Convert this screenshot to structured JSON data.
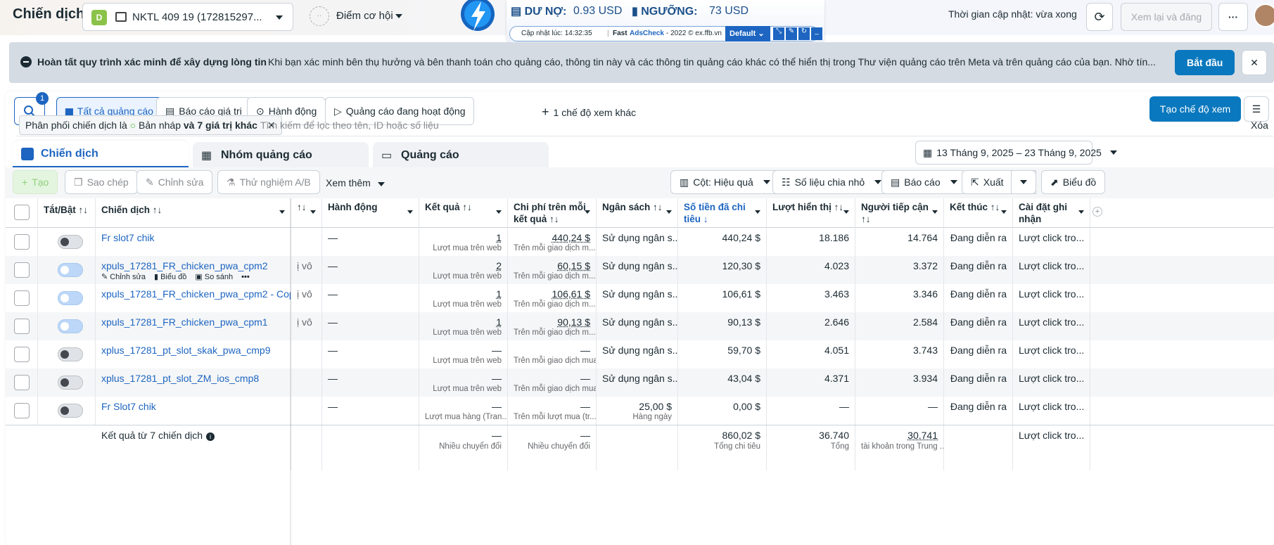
{
  "topbar": {
    "title": "Chiến dịch",
    "account_badge": "D",
    "account_name": "NKTL 409 19 (172815297...",
    "opportunity": "Điểm cơ hội",
    "debt_label": "DƯ NỢ:",
    "debt_value": "0.93 USD",
    "threshold_label": "NGƯỠNG:",
    "threshold_value": "73 USD",
    "ext_update": "Cập nhật lúc: 14:32:35",
    "ext_brand_fast": "Fast",
    "ext_brand_name": "AdsCheck",
    "ext_copyright": "- 2022 © ex.ffb.vn",
    "ext_profile": "Default",
    "update_time": "Thời gian cập nhật: vừa xong",
    "review_publish": "Xem lại và đăng",
    "more": "···"
  },
  "banner": {
    "title": "Hoàn tất quy trình xác minh để xây dựng lòng tin",
    "text": "Khi bạn xác minh bên thụ hưởng và bên thanh toán cho quảng cáo, thông tin này và các thông tin quảng cáo khác có thể hiển thị trong Thư viện quảng cáo trên Meta và trên quảng cáo của bạn. Nhờ tín...",
    "start": "Bắt đầu",
    "close": "✕"
  },
  "views": {
    "search_badge": "1",
    "all_campaigns": "Tất cả quảng cáo",
    "value_report": "Báo cáo giá trị",
    "actions": "Hành động",
    "active_ads": "Quảng cáo đang hoạt động",
    "more_views": "1 chế độ xem khác",
    "create_view": "Tạo chế độ xem"
  },
  "filter": {
    "chip_prefix": "Phân phối chiến dịch là",
    "chip_value": "Bản nháp",
    "chip_more": "và 7 giá trị khác",
    "search_placeholder": "Tìm kiếm để lọc theo tên, ID hoặc số liệu",
    "clear": "Xóa"
  },
  "tabs": {
    "campaigns": "Chiến dịch",
    "adsets": "Nhóm quảng cáo",
    "ads": "Quảng cáo",
    "date_range": "13 Tháng 9, 2025 – 23 Tháng 9, 2025"
  },
  "toolbar": {
    "create": "Tạo",
    "copy": "Sao chép",
    "edit": "Chỉnh sửa",
    "ab_test": "Thử nghiệm A/B",
    "see_more": "Xem thêm",
    "columns": "Cột: Hiệu quả",
    "breakdown": "Số liệu chia nhỏ",
    "reports": "Báo cáo",
    "export": "Xuất",
    "chart": "Biểu đồ"
  },
  "headers": {
    "toggle": "Tắt/Bật ↑↓",
    "campaign": "Chiến dịch ↑↓",
    "hidden": "↑↓",
    "action": "Hành động",
    "results": "Kết quả ↑↓",
    "cost_per": "Chi phí trên mỗi kết quả ↑↓",
    "budget": "Ngân sách ↑↓",
    "spent": "Số tiền đã chi tiêu ↓",
    "impressions": "Lượt hiển thị ↑↓",
    "reach": "Người tiếp cận ↑↓",
    "ends": "Kết thúc ↑↓",
    "attribution": "Cài đặt ghi nhận"
  },
  "row_actions": {
    "edit": "Chỉnh sửa",
    "chart": "Biểu đồ",
    "compare": "So sánh",
    "more": "•••"
  },
  "rows": [
    {
      "name": "Fr slot7 chik",
      "on": false,
      "hidden": "",
      "action": "—",
      "result": "1",
      "result_sub": "Lượt mua trên web",
      "cost": "440,24 $",
      "cost_sub": "Trên mỗi giao dịch m...",
      "budget": "Sử dụng ngân s...",
      "budget_sub": "",
      "spent": "440,24 $",
      "impr": "18.186",
      "reach": "14.764",
      "ends": "Đang diễn ra",
      "attr": "Lượt click tro..."
    },
    {
      "name": "xpuls_17281_FR_chicken_pwa_cpm2",
      "on": true,
      "hidden": "ị vô",
      "action": "—",
      "result": "2",
      "result_sub": "Lượt mua trên web",
      "cost": "60,15 $",
      "cost_sub": "Trên mỗi giao dịch m...",
      "budget": "Sử dụng ngân s...",
      "budget_sub": "",
      "spent": "120,30 $",
      "impr": "4.023",
      "reach": "3.372",
      "ends": "Đang diễn ra",
      "attr": "Lượt click tro..."
    },
    {
      "name": "xpuls_17281_FR_chicken_pwa_cpm2 - Copy",
      "on": true,
      "hidden": "ị vô",
      "action": "—",
      "result": "1",
      "result_sub": "Lượt mua trên web",
      "cost": "106,61 $",
      "cost_sub": "Trên mỗi giao dịch m...",
      "budget": "Sử dụng ngân s...",
      "budget_sub": "",
      "spent": "106,61 $",
      "impr": "3.463",
      "reach": "3.346",
      "ends": "Đang diễn ra",
      "attr": "Lượt click tro..."
    },
    {
      "name": "xpuls_17281_FR_chicken_pwa_cpm1",
      "on": true,
      "hidden": "ị vô",
      "action": "—",
      "result": "1",
      "result_sub": "Lượt mua trên web",
      "cost": "90,13 $",
      "cost_sub": "Trên mỗi giao dịch m...",
      "budget": "Sử dụng ngân s...",
      "budget_sub": "",
      "spent": "90,13 $",
      "impr": "2.646",
      "reach": "2.584",
      "ends": "Đang diễn ra",
      "attr": "Lượt click tro..."
    },
    {
      "name": "xplus_17281_pt_slot_skak_pwa_cmp9",
      "on": false,
      "hidden": "",
      "action": "—",
      "result": "—",
      "result_sub": "Lượt mua trên web",
      "cost": "—",
      "cost_sub": "Trên mỗi giao dịch mua",
      "budget": "Sử dụng ngân s...",
      "budget_sub": "",
      "spent": "59,70 $",
      "impr": "4.051",
      "reach": "3.743",
      "ends": "Đang diễn ra",
      "attr": "Lượt click tro..."
    },
    {
      "name": "xplus_17281_pt_slot_ZM_ios_cmp8",
      "on": false,
      "hidden": "",
      "action": "—",
      "result": "—",
      "result_sub": "Lượt mua trên web",
      "cost": "—",
      "cost_sub": "Trên mỗi giao dịch mua",
      "budget": "Sử dụng ngân s...",
      "budget_sub": "",
      "spent": "43,04 $",
      "impr": "4.371",
      "reach": "3.934",
      "ends": "Đang diễn ra",
      "attr": "Lượt click tro..."
    },
    {
      "name": "Fr Slot7 chik",
      "on": false,
      "hidden": "",
      "action": "—",
      "result": "—",
      "result_sub": "Lượt mua hàng (Tran...",
      "cost": "—",
      "cost_sub": "Trên mỗi lượt mua (tr...",
      "budget": "25,00 $",
      "budget_sub": "Hàng ngày",
      "spent": "0,00 $",
      "impr": "—",
      "reach": "—",
      "ends": "Đang diễn ra",
      "attr": "Lượt click tro..."
    }
  ],
  "totals": {
    "label": "Kết quả từ 7 chiến dịch",
    "result": "—",
    "result_sub": "Nhiều chuyển đổi",
    "cost": "—",
    "cost_sub": "Nhiều chuyển đổi",
    "spent": "860,02 $",
    "spent_sub": "Tổng chi tiêu",
    "impr": "36.740",
    "impr_sub": "Tổng",
    "reach": "30.741",
    "reach_sub": "tài khoản trong Trung ...",
    "attr": "Lượt click tro..."
  }
}
